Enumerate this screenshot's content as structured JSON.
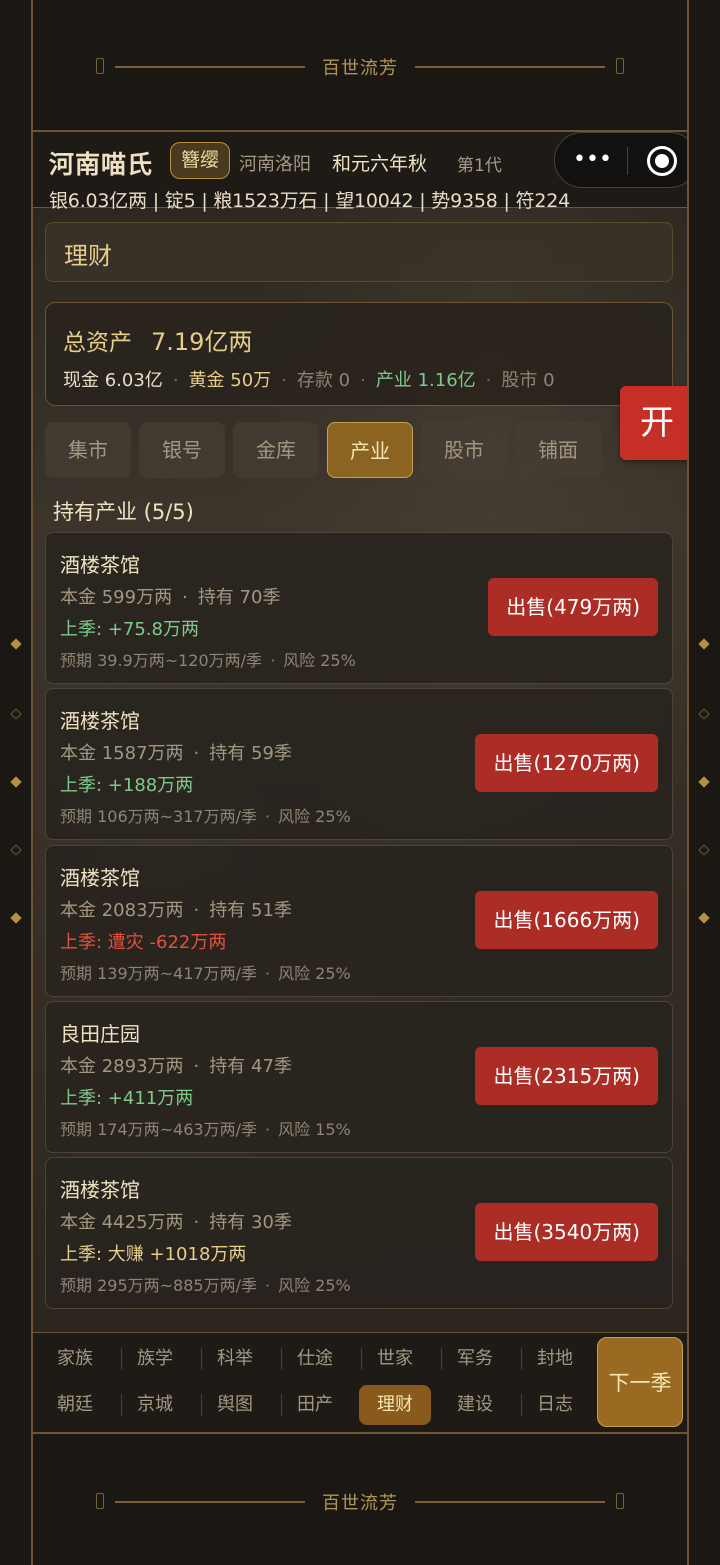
{
  "banner": {
    "title": "百世流芳"
  },
  "header": {
    "family_name": "河南喵氏",
    "tag": "簪缨",
    "place": "河南洛阳",
    "era": "和元六年秋",
    "generation": "第1代",
    "stats": "银6.03亿两 | 锭5 | 粮1523万石 | 望10042 | 势9358 | 符224"
  },
  "capsule": {
    "more_glyph": "•••",
    "close_icon": "target-icon"
  },
  "section": {
    "title": "理财"
  },
  "assets": {
    "total_label": "总资产",
    "total_value": "7.19亿两",
    "cash": "现金 6.03亿",
    "gold": "黄金 50万",
    "deposit": "存款 0",
    "industry": "产业 1.16亿",
    "stock": "股市 0"
  },
  "open_button": "开",
  "tabs": [
    "集市",
    "银号",
    "金库",
    "产业",
    "股市",
    "铺面"
  ],
  "active_tab": "产业",
  "holdings_title": "持有产业 (5/5)",
  "holdings": [
    {
      "name": "酒楼茶馆",
      "principal": "本金 599万两",
      "held": "持有 70季",
      "last": "上季: +75.8万两",
      "last_type": "up",
      "expected": "预期 39.9万两~120万两/季",
      "risk": "风险 25%",
      "sell": "出售(479万两)"
    },
    {
      "name": "酒楼茶馆",
      "principal": "本金 1587万两",
      "held": "持有 59季",
      "last": "上季: +188万两",
      "last_type": "up",
      "expected": "预期 106万两~317万两/季",
      "risk": "风险 25%",
      "sell": "出售(1270万两)"
    },
    {
      "name": "酒楼茶馆",
      "principal": "本金 2083万两",
      "held": "持有 51季",
      "last": "上季: 遭灾 -622万两",
      "last_type": "down",
      "expected": "预期 139万两~417万两/季",
      "risk": "风险 25%",
      "sell": "出售(1666万两)"
    },
    {
      "name": "良田庄园",
      "principal": "本金 2893万两",
      "held": "持有 47季",
      "last": "上季: +411万两",
      "last_type": "up",
      "expected": "预期 174万两~463万两/季",
      "risk": "风险 15%",
      "sell": "出售(2315万两)"
    },
    {
      "name": "酒楼茶馆",
      "principal": "本金 4425万两",
      "held": "持有 30季",
      "last": "上季: 大赚 +1018万两",
      "last_type": "big",
      "expected": "预期 295万两~885万两/季",
      "risk": "风险 25%",
      "sell": "出售(3540万两)"
    }
  ],
  "bottom_nav": {
    "row1": [
      "家族",
      "族学",
      "科举",
      "仕途",
      "世家",
      "军务",
      "封地"
    ],
    "row2": [
      "朝廷",
      "京城",
      "舆图",
      "田产",
      "理财",
      "建设",
      "日志"
    ],
    "active": "理财",
    "next_label": "下一季"
  },
  "colors": {
    "accent_gold": "#e6cd8a",
    "sell_red": "#ac2d26",
    "gain_green": "#7fc98a",
    "loss_red": "#e0523d",
    "active_tab": "#8a6420"
  }
}
